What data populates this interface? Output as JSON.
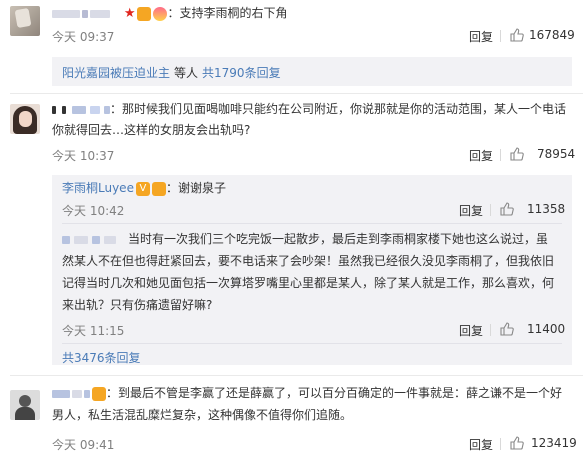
{
  "comments": [
    {
      "text": "：支持李雨桐的右下角",
      "time": "今天 09:37",
      "reply_label": "回复",
      "likes": "167849",
      "sub_summary": {
        "user": "阳光嘉园被压迫业主",
        "middle": "等人",
        "link": "共1790条回复"
      }
    },
    {
      "line1": "：那时候我们见面喝咖啡只能约在公司附近，你说那就是你的活动范围，某人一个电话",
      "line2": "你就得回去…这样的女朋友会出轨吗?",
      "time": "今天 10:37",
      "reply_label": "回复",
      "likes": "78954",
      "replies": [
        {
          "user": "李雨桐Luyee",
          "text": "：谢谢泉子",
          "time": "今天 10:42",
          "reply_label": "回复",
          "likes": "11358"
        },
        {
          "line1": "当时有一次我们三个吃完饭一起散步，最后走到李雨桐家楼下她也这么说过，虽",
          "line2": "然某人不在但也得赶紧回去，要不电话来了会吵架！虽然我已经很久没见李雨桐了，但我依旧",
          "line3": "记得当时几次和她见面包括一次算塔罗嘴里心里都是某人，除了某人就是工作，那么喜欢，何",
          "line4": "来出轨？只有伤痛遗留好嘛?",
          "time": "今天 11:15",
          "reply_label": "回复",
          "likes": "11400"
        }
      ],
      "more_link": "共3476条回复"
    },
    {
      "line1": "：到最后不管是李赢了还是薛赢了，可以百分百确定的一件事就是：薛之谦不是一个好",
      "line2": "男人，私生活混乱糜烂复杂，这种偶像不值得你们追随。",
      "time": "今天 09:41",
      "reply_label": "回复",
      "likes": "123419"
    }
  ],
  "colors": {
    "link": "#4a7bb7",
    "meta": "#808080",
    "reply_bg": "#f2f2f5",
    "text": "#333333"
  },
  "icons": [
    "thumbs-up-icon",
    "star-icon",
    "vip-badge-icon",
    "heart-balloon-icon",
    "verified-v-icon"
  ]
}
